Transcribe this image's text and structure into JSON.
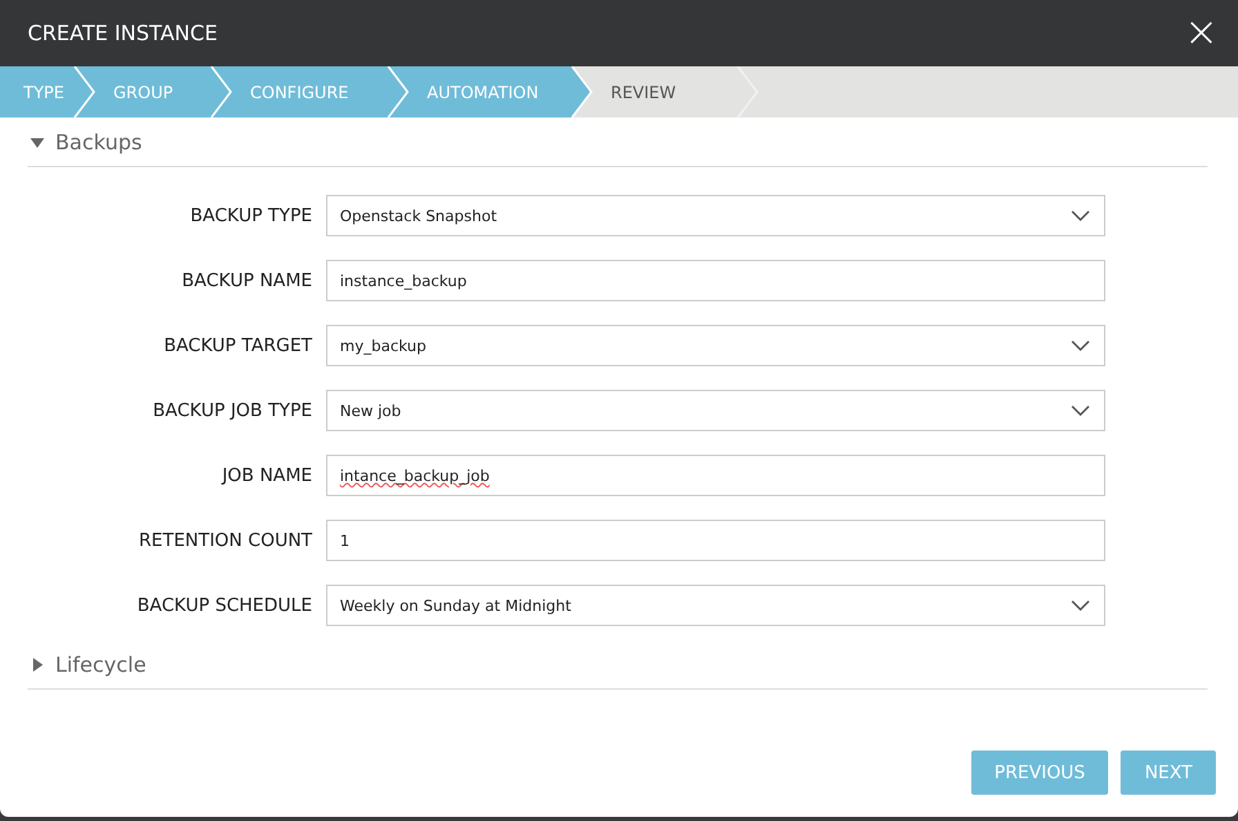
{
  "window": {
    "title": "CREATE INSTANCE",
    "close": "×"
  },
  "steps": [
    {
      "label": "TYPE",
      "completed": true
    },
    {
      "label": "GROUP",
      "completed": true
    },
    {
      "label": "CONFIGURE",
      "completed": true
    },
    {
      "label": "AUTOMATION",
      "completed": true
    },
    {
      "label": "REVIEW",
      "completed": false
    }
  ],
  "sections": [
    {
      "title": "Backups",
      "expanded": true,
      "fields": [
        {
          "label": "BACKUP TYPE",
          "kind": "select",
          "value": "Openstack Snapshot"
        },
        {
          "label": "BACKUP NAME",
          "kind": "text",
          "value": "instance_backup"
        },
        {
          "label": "BACKUP TARGET",
          "kind": "select",
          "value": "my_backup"
        },
        {
          "label": "BACKUP JOB TYPE",
          "kind": "select",
          "value": "New job"
        },
        {
          "label": "JOB NAME",
          "kind": "text",
          "value": "intance_backup_job",
          "misspelled": true
        },
        {
          "label": "RETENTION COUNT",
          "kind": "text",
          "value": "1"
        },
        {
          "label": "BACKUP SCHEDULE",
          "kind": "select",
          "value": "Weekly on Sunday at Midnight"
        }
      ]
    },
    {
      "title": "Lifecycle",
      "expanded": false
    }
  ],
  "buttons": [
    "PREVIOUS",
    "NEXT"
  ]
}
